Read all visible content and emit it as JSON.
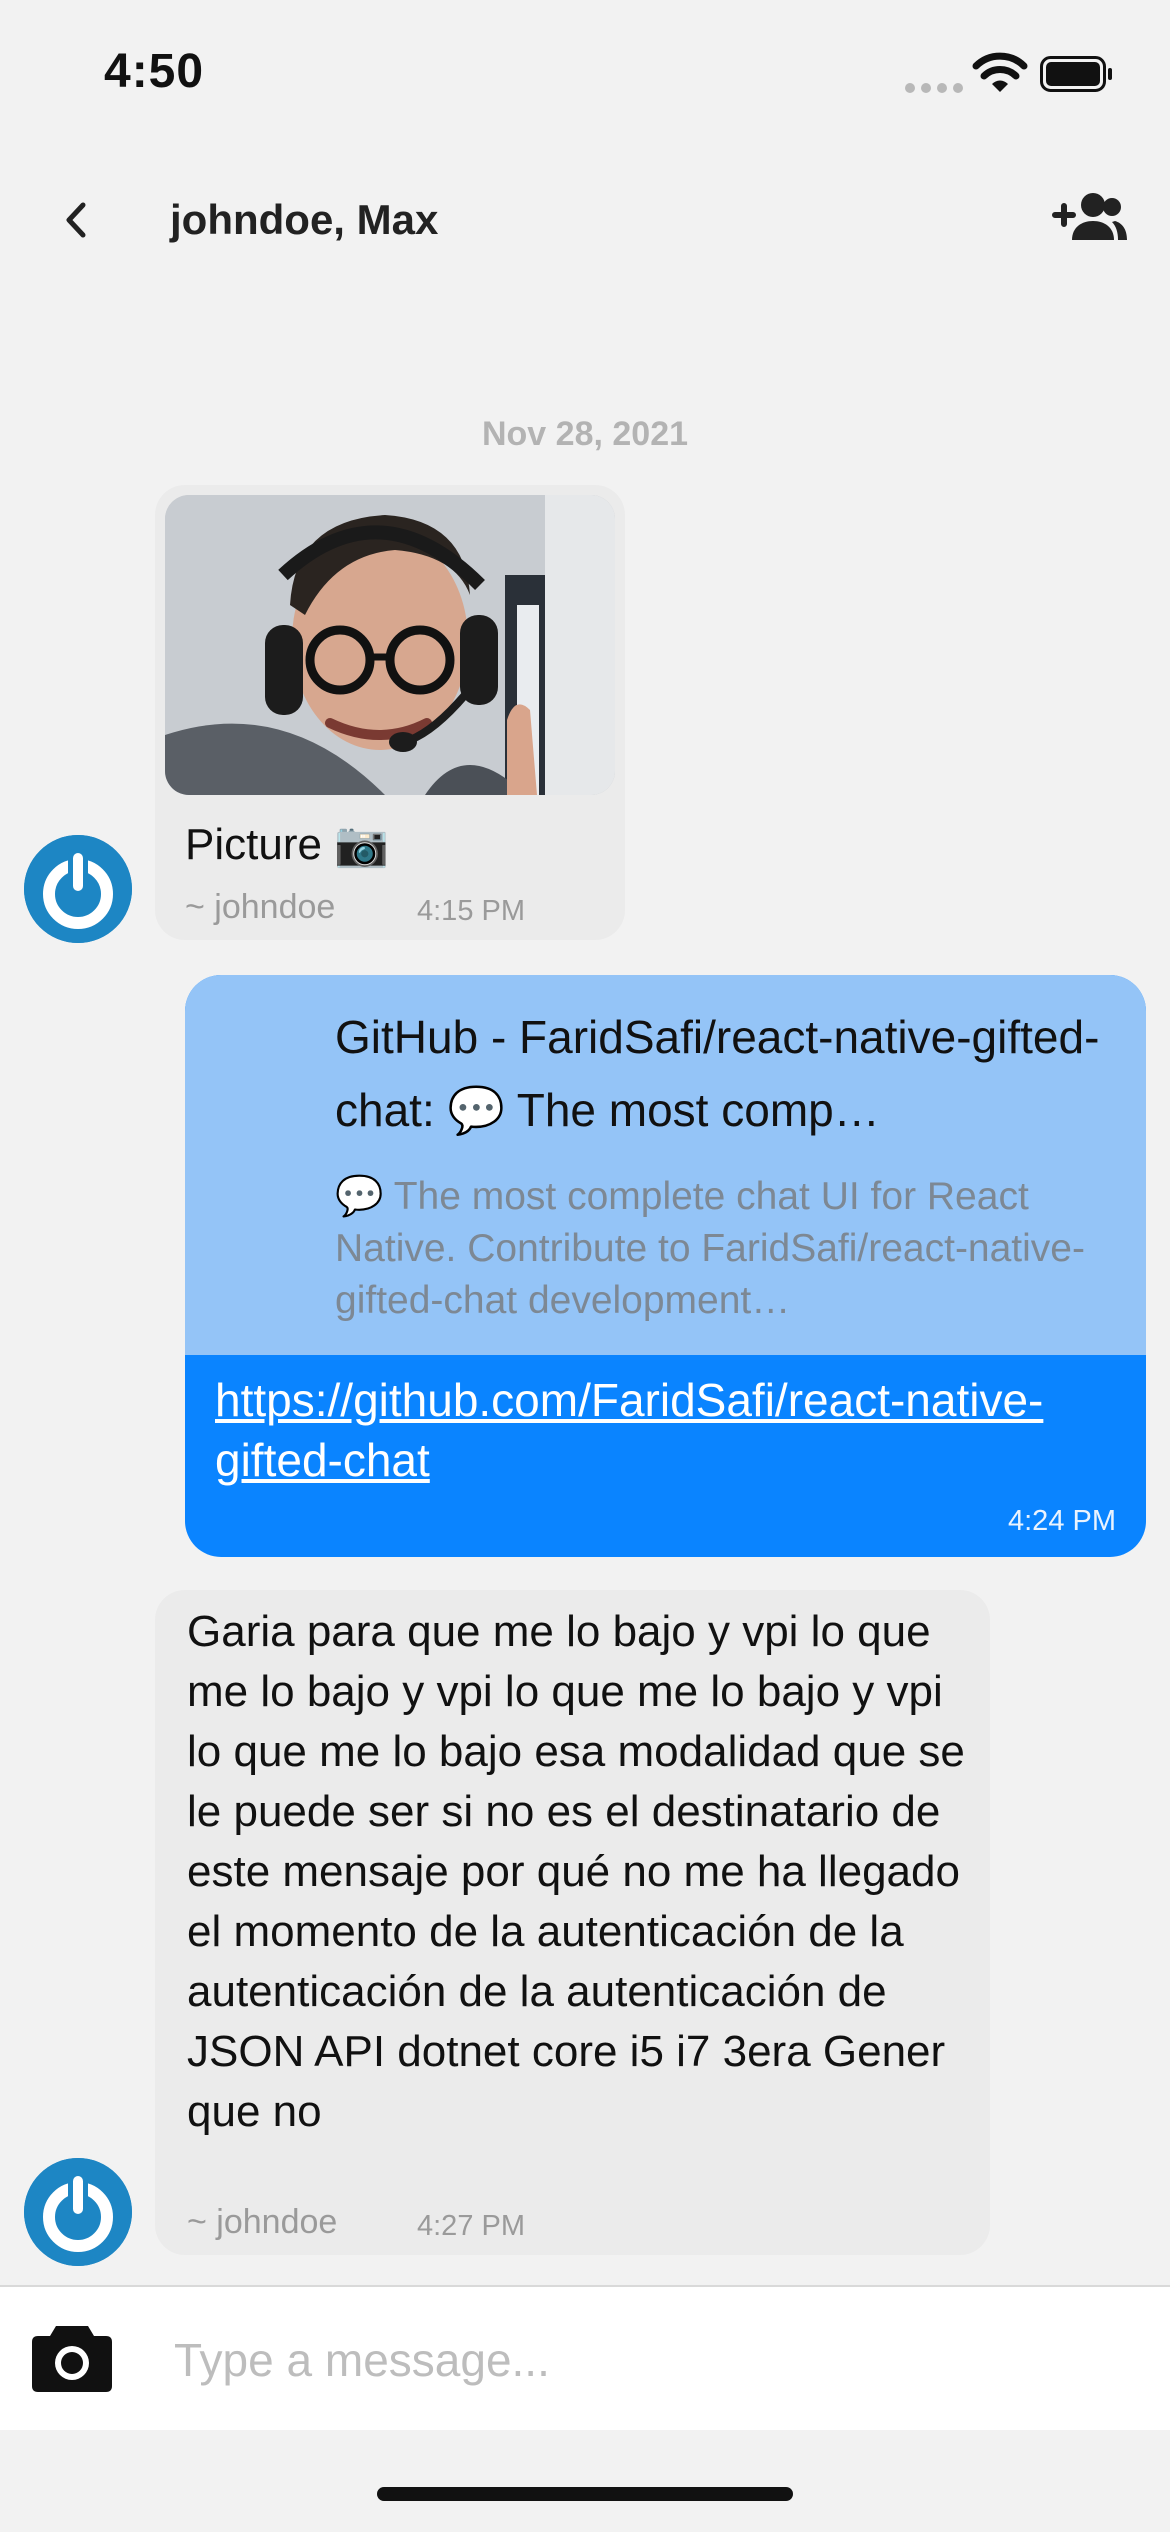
{
  "status_bar": {
    "time": "4:50"
  },
  "header": {
    "title": "johndoe, Max"
  },
  "date_separator": "Nov 28, 2021",
  "messages": [
    {
      "sender": "~ johndoe",
      "text": "Picture 📷",
      "time": "4:15 PM"
    },
    {
      "preview_title": "GitHub - FaridSafi/react-native-gifted-chat: 💬 The most comp…",
      "preview_description": "💬 The most complete chat UI for React Native. Contribute to FaridSafi/react-native-gifted-chat development…",
      "link": "https://github.com/FaridSafi/react-native-gifted-chat",
      "time": "4:24 PM"
    },
    {
      "sender": "~ johndoe",
      "text": "Garia para que me lo bajo y vpi lo que me lo bajo y vpi lo que me lo bajo y vpi lo que me lo bajo esa modalidad que se le puede ser si no es el destinatario de este mensaje por qué no me ha llegado el momento de la autenticación de la autenticación de la autenticación de JSON API dotnet core i5 i7 3era Gener que no",
      "time": "4:27 PM"
    }
  ],
  "composer": {
    "placeholder": "Type a message..."
  },
  "icons": {
    "back": "chevron-left-icon",
    "add_member": "person-add-icon",
    "camera": "camera-icon",
    "avatar": "power-icon"
  },
  "colors": {
    "outgoing_bubble": "#0a84ff",
    "link_preview": "#94c4f7",
    "incoming_bubble": "#ebebeb",
    "avatar": "#1d86c4"
  }
}
